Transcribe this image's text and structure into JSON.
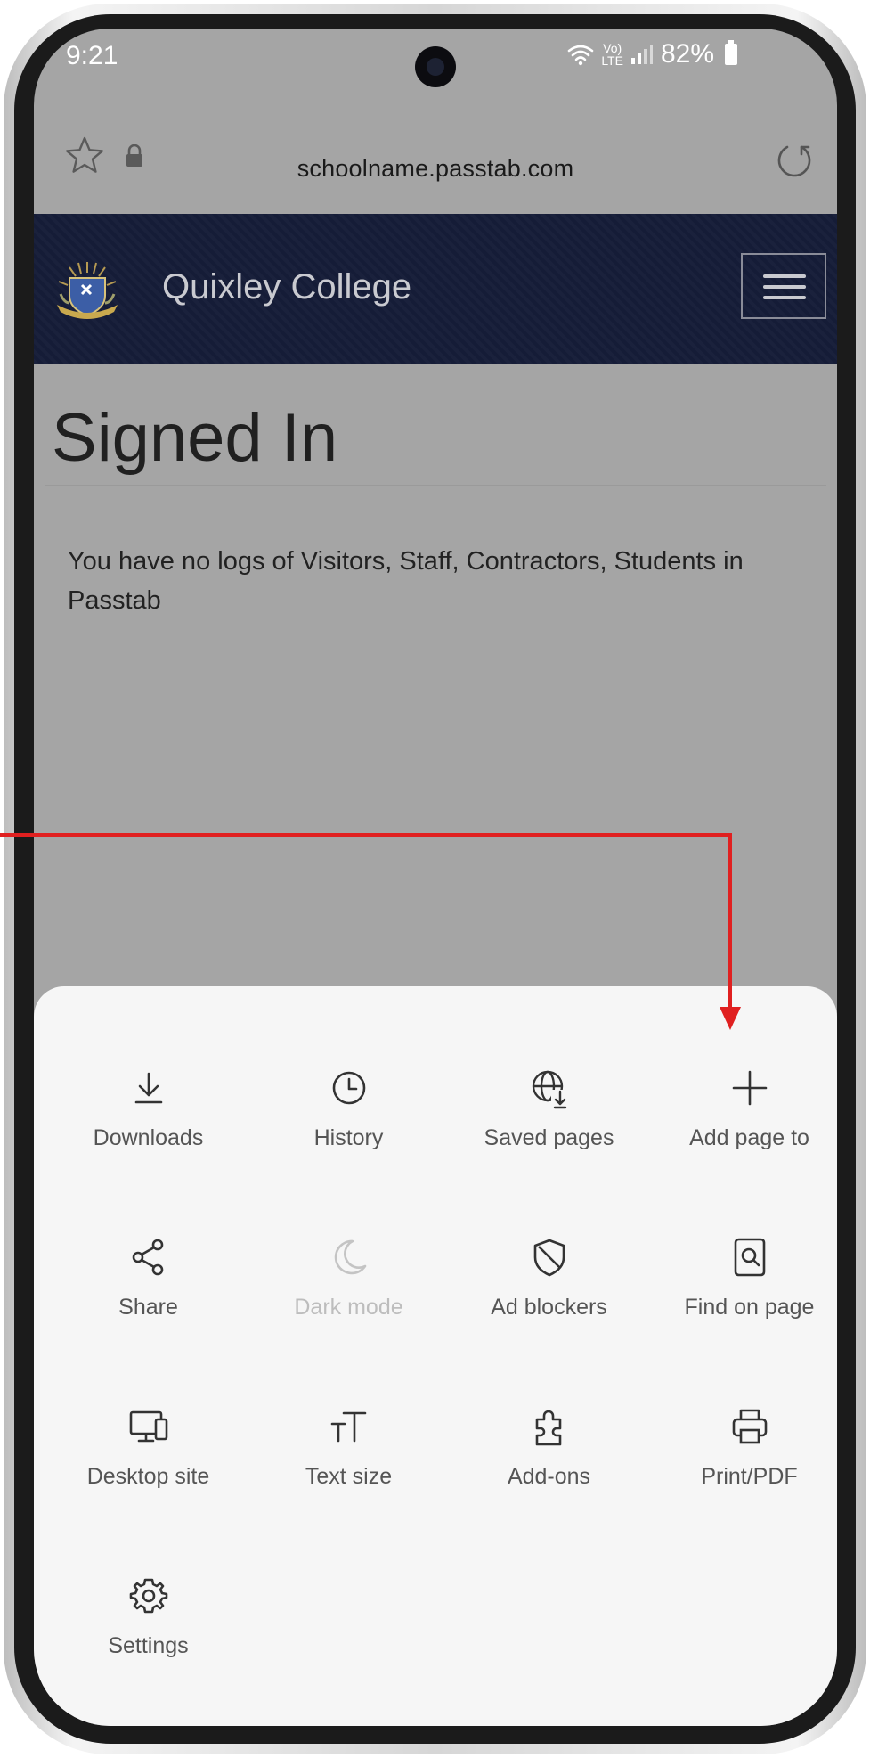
{
  "status_bar": {
    "time": "9:21",
    "network_top": "Vo)",
    "network_bottom": "LTE",
    "battery": "82%"
  },
  "browser": {
    "url": "schoolname.passtab.com"
  },
  "site": {
    "name": "Quixley College",
    "header_color": "#151c37"
  },
  "page": {
    "title": "Signed In",
    "message": "You have no logs of Visitors, Staff, Contractors, Students in Passtab"
  },
  "menu": {
    "items": [
      {
        "label": "Downloads",
        "icon": "download-icon"
      },
      {
        "label": "History",
        "icon": "clock-icon"
      },
      {
        "label": "Saved pages",
        "icon": "globe-download-icon"
      },
      {
        "label": "Add page to",
        "icon": "plus-icon"
      },
      {
        "label": "Share",
        "icon": "share-icon"
      },
      {
        "label": "Dark mode",
        "icon": "moon-icon",
        "disabled": true
      },
      {
        "label": "Ad blockers",
        "icon": "shield-icon"
      },
      {
        "label": "Find on page",
        "icon": "search-page-icon"
      },
      {
        "label": "Desktop site",
        "icon": "monitor-icon"
      },
      {
        "label": "Text size",
        "icon": "text-size-icon"
      },
      {
        "label": "Add-ons",
        "icon": "puzzle-icon"
      },
      {
        "label": "Print/PDF",
        "icon": "printer-icon"
      },
      {
        "label": "Settings",
        "icon": "gear-icon"
      }
    ]
  },
  "annotation": {
    "arrow_color": "#e02020"
  }
}
